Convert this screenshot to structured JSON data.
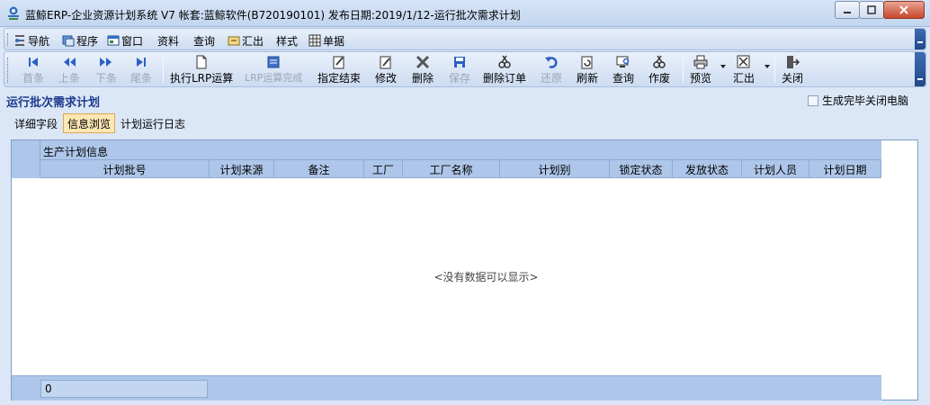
{
  "window": {
    "title": "蓝鲸ERP-企业资源计划系统 V7 帐套:蓝鲸软件(B720190101) 发布日期:2019/1/12-运行批次需求计划"
  },
  "menu": {
    "items": [
      {
        "label": "导航",
        "icon": "navigation-icon"
      },
      {
        "label": "程序",
        "icon": "program-icon"
      },
      {
        "label": "窗口",
        "icon": "window-icon"
      },
      {
        "label": "资料",
        "icon": ""
      },
      {
        "label": "查询",
        "icon": ""
      },
      {
        "label": "汇出",
        "icon": "export-icon"
      },
      {
        "label": "样式",
        "icon": ""
      },
      {
        "label": "单据",
        "icon": "document-icon"
      }
    ]
  },
  "toolbar": {
    "first": "首条",
    "prev": "上条",
    "next": "下条",
    "last": "尾条",
    "run_lrp": "执行LRP运算",
    "lrp_done": "LRP运算完成",
    "assign_end": "指定结束",
    "modify": "修改",
    "delete": "删除",
    "save": "保存",
    "delete_order": "删除订单",
    "restore": "还原",
    "refresh": "刷新",
    "query": "查询",
    "void": "作废",
    "preview": "预览",
    "export": "汇出",
    "close": "关闭"
  },
  "page": {
    "title": "运行批次需求计划",
    "close_after_done_label": "生成完毕关闭电脑",
    "close_after_done_checked": false
  },
  "tabs": [
    {
      "label": "详细字段",
      "active": false
    },
    {
      "label": "信息浏览",
      "active": true
    },
    {
      "label": "计划运行日志",
      "active": false
    }
  ],
  "grid": {
    "group_header": "生产计划信息",
    "columns": [
      "计划批号",
      "计划来源",
      "备注",
      "工厂",
      "工厂名称",
      "计划别",
      "锁定状态",
      "发放状态",
      "计划人员",
      "计划日期"
    ],
    "rows": [],
    "empty_message": "<没有数据可以显示>",
    "footer_value": "0"
  },
  "colors": {
    "header_bg": "#aec6e9",
    "accent_title": "#1e3a8a",
    "active_tab": "#fde8b4"
  }
}
